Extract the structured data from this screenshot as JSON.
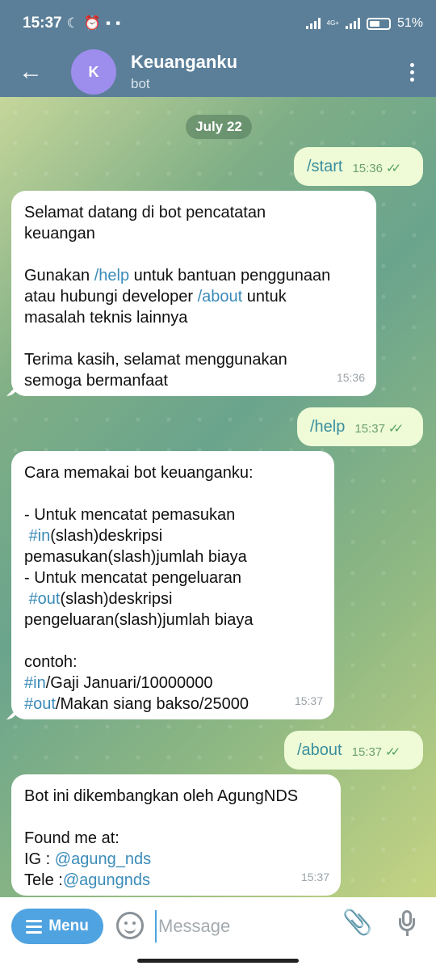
{
  "status": {
    "time": "15:37",
    "network": "4G+",
    "battery": "51",
    "battery_suffix": "%"
  },
  "header": {
    "avatar_letter": "K",
    "title": "Keuanganku",
    "subtitle": "bot"
  },
  "chat": {
    "date": "July 22",
    "messages": [
      {
        "dir": "out",
        "text": "/start",
        "time": "15:36"
      },
      {
        "dir": "in",
        "time": "15:36",
        "lines": {
          "l1": "Selamat datang di bot pencatatan",
          "l2": "keuangan",
          "l3a": "Gunakan ",
          "l3b": "/help",
          "l3c": " untuk bantuan penggunaan",
          "l4a": "atau hubungi developer ",
          "l4b": "/about",
          "l4c": " untuk",
          "l5": "masalah teknis lainnya",
          "l6": "Terima kasih, selamat menggunakan",
          "l7": "semoga bermanfaat"
        }
      },
      {
        "dir": "out",
        "text": "/help",
        "time": "15:37"
      },
      {
        "dir": "in",
        "time": "15:37",
        "lines": {
          "l1": "Cara memakai bot keuanganku:",
          "l2": "- Untuk mencatat pemasukan",
          "l3a": "#in",
          "l3b": "(slash)deskripsi",
          "l4": "pemasukan(slash)jumlah biaya",
          "l5": "- Untuk mencatat pengeluaran",
          "l6a": "#out",
          "l6b": "(slash)deskripsi",
          "l7": "pengeluaran(slash)jumlah biaya",
          "l8": "contoh:",
          "l9a": "#in",
          "l9b": "/Gaji Januari/10000000",
          "l10a": "#out",
          "l10b": "/Makan siang bakso/25000"
        }
      },
      {
        "dir": "out",
        "text": "/about",
        "time": "15:37"
      },
      {
        "dir": "in",
        "time": "15:37",
        "lines": {
          "l1": "Bot ini dikembangkan oleh AgungNDS",
          "l2": "Found me at:",
          "l3a": "IG : ",
          "l3b": "@agung_nds",
          "l4a": "Tele :",
          "l4b": "@agungnds"
        }
      }
    ]
  },
  "input": {
    "menu_label": "Menu",
    "placeholder": "Message"
  }
}
